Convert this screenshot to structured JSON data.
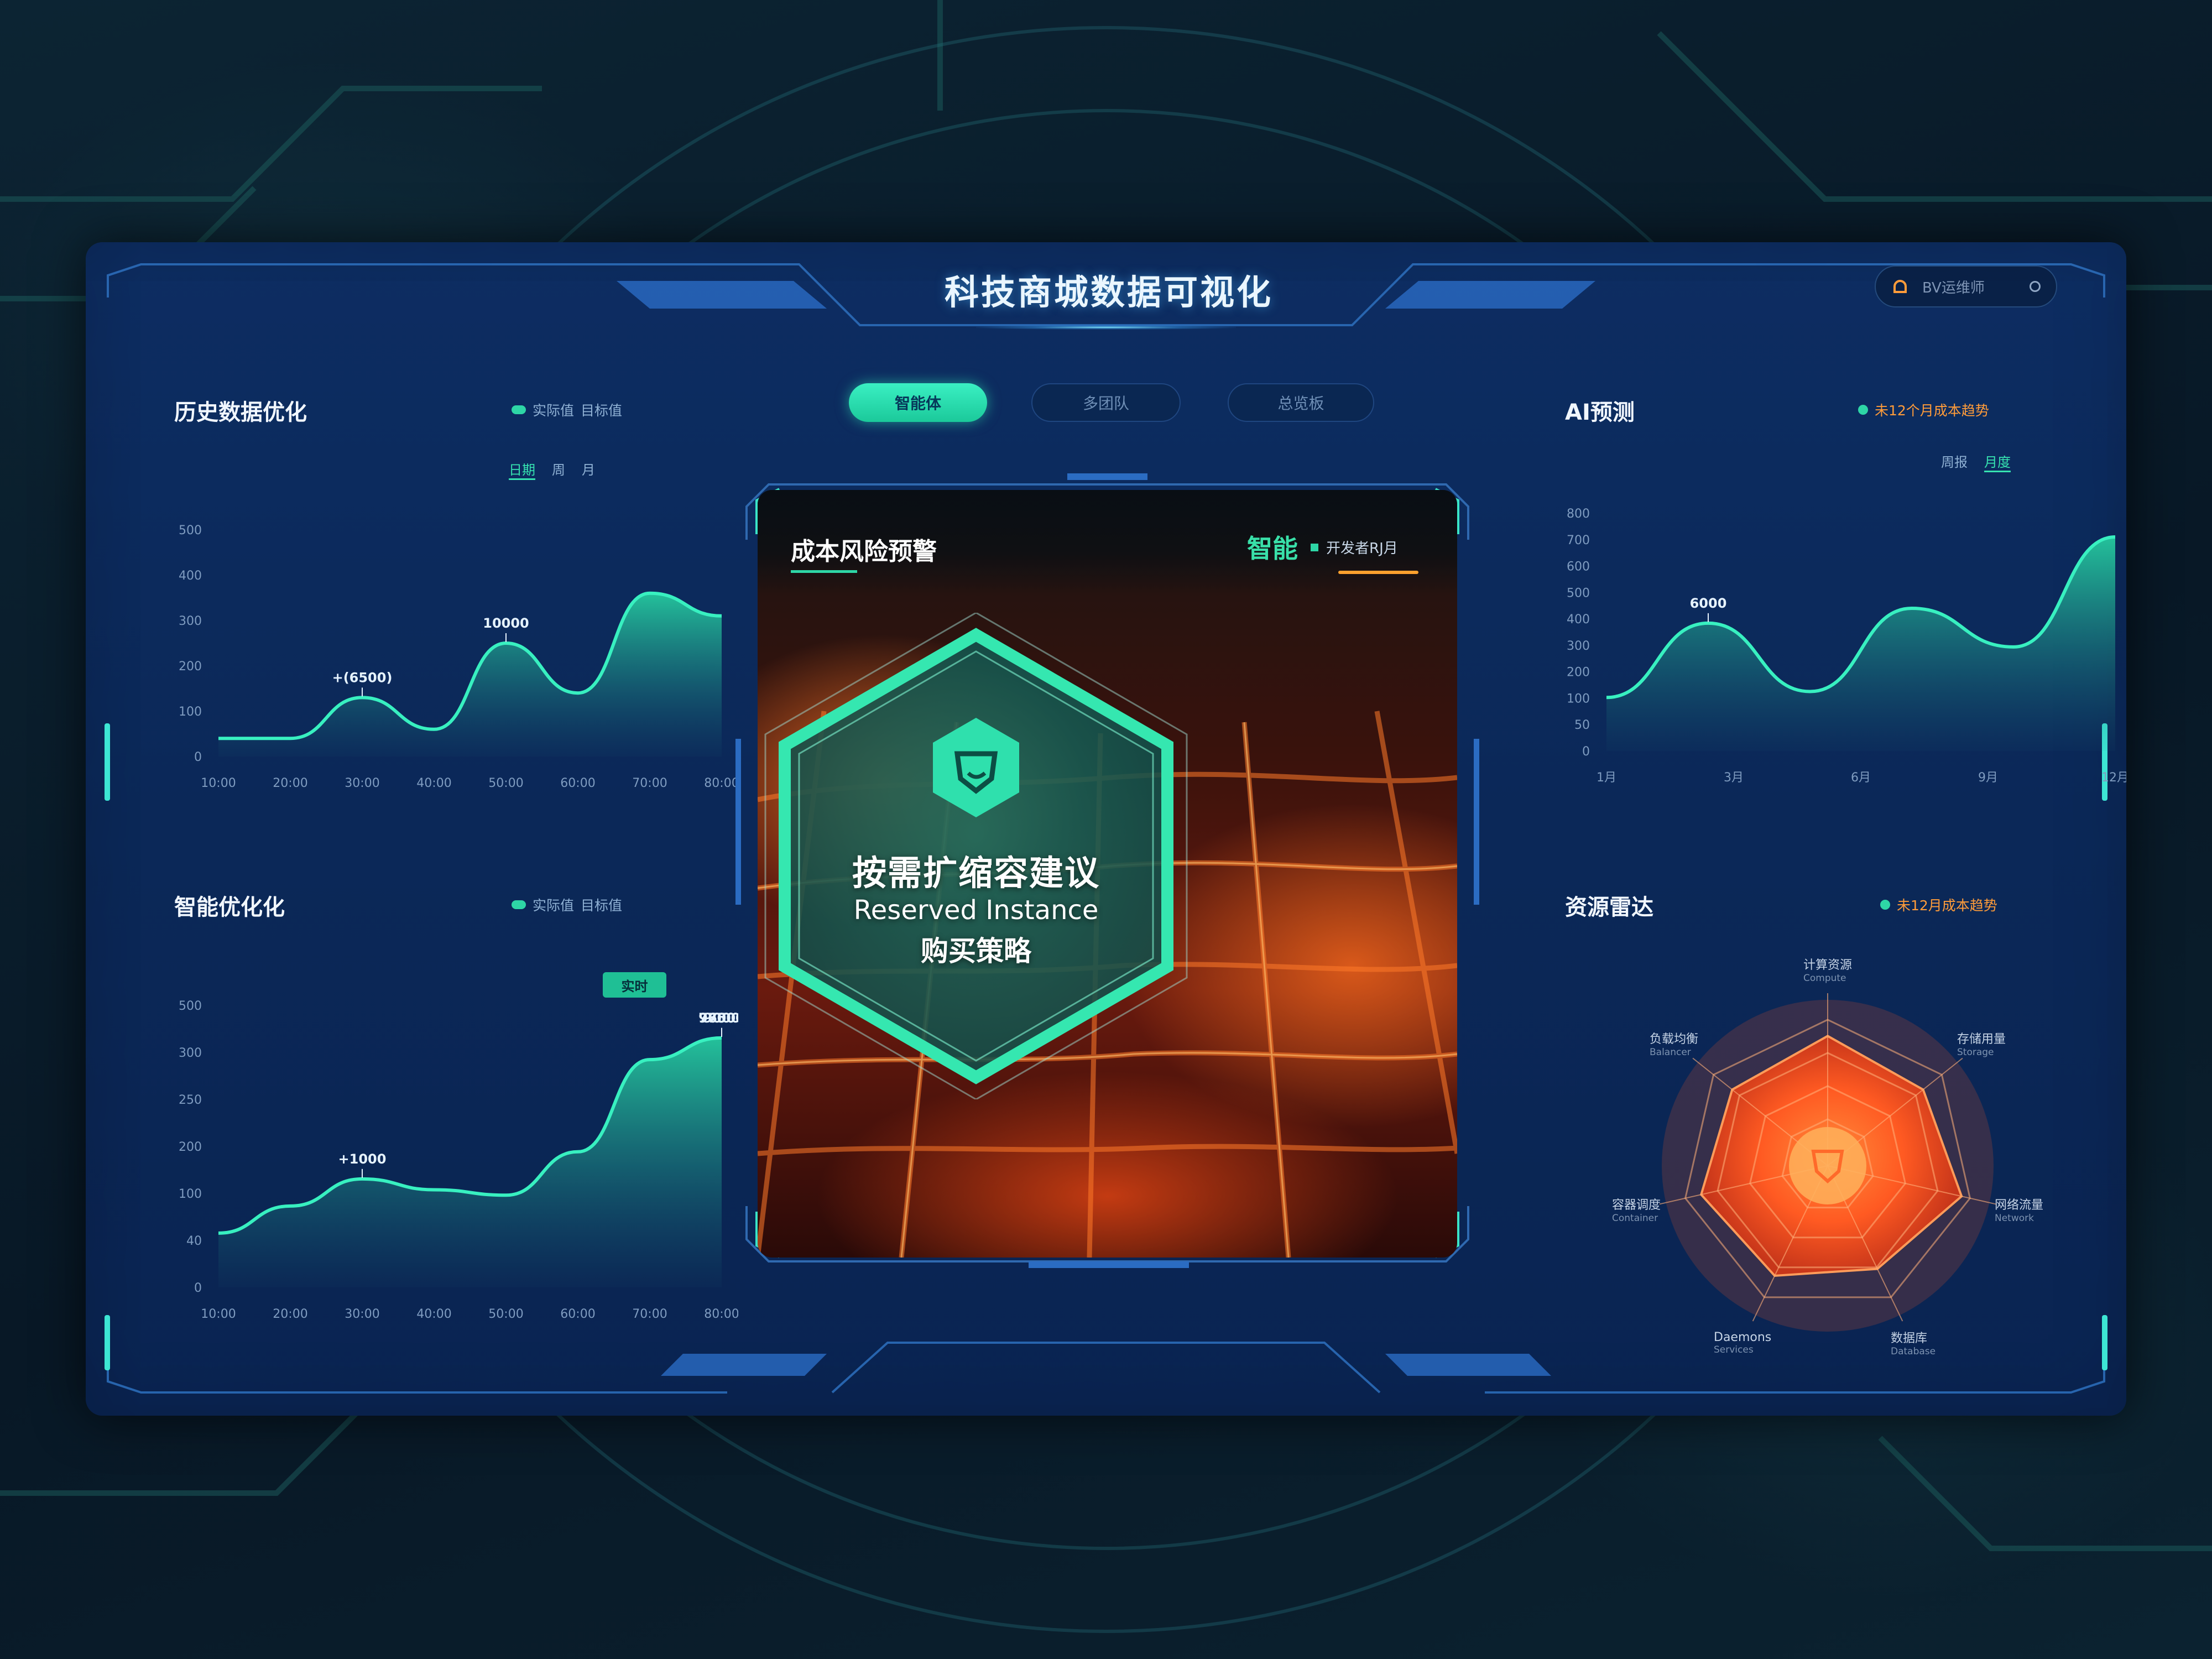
{
  "header": {
    "title": "科技商城数据可视化",
    "user_name": "BV运维师"
  },
  "tabs": [
    {
      "label": "智能体"
    },
    {
      "label": "多团队"
    },
    {
      "label": "总览板"
    }
  ],
  "left_top": {
    "title": "历史数据优化",
    "legend_label": "实际值",
    "legend_extra": "目标值",
    "filters": [
      "日期",
      "周",
      "月"
    ],
    "annotations": [
      "+(6500)",
      "10000"
    ]
  },
  "left_bottom": {
    "title": "智能优化化",
    "legend_label": "实际值",
    "legend_extra": "目标值",
    "badge": "实时",
    "annotations": [
      "+1000",
      "9000",
      "76000",
      "97500"
    ]
  },
  "right_top": {
    "title": "AI预测",
    "legend_label": "未12个月成本趋势",
    "filters": [
      "周报",
      "月度"
    ],
    "annotation": "6000"
  },
  "right_bottom": {
    "title": "资源雷达",
    "legend_label": "未12月成本趋势"
  },
  "center": {
    "title": "成本风险预警",
    "badge": "智能",
    "meta": "开发者RJ月",
    "hex_main": "按需扩缩容建议",
    "hex_sub1": "Reserved Instance",
    "hex_sub2": "购买策略"
  },
  "radar_labels": [
    {
      "label": "计算资源",
      "sub": "Compute"
    },
    {
      "label": "存储用量",
      "sub": "Storage"
    },
    {
      "label": "网络流量",
      "sub": "Network"
    },
    {
      "label": "数据库",
      "sub": "Database"
    },
    {
      "label": "Daemons",
      "sub": "Services"
    },
    {
      "label": "容器调度",
      "sub": "Container"
    },
    {
      "label": "负载均衡",
      "sub": "Balancer"
    }
  ],
  "chart_data": [
    {
      "type": "area",
      "title": "历史数据优化",
      "x": [
        "10:00",
        "20:00",
        "30:00",
        "40:00",
        "50:00",
        "60:00",
        "70:00",
        "80:00"
      ],
      "series": [
        {
          "name": "实际值",
          "values": [
            40,
            40,
            130,
            60,
            250,
            140,
            360,
            310
          ]
        }
      ],
      "yticks": [
        "0",
        "100",
        "200",
        "300",
        "400",
        "500"
      ],
      "ylim": [
        0,
        500
      ]
    },
    {
      "type": "area",
      "title": "智能优化化",
      "x": [
        "10:00",
        "20:00",
        "30:00",
        "40:00",
        "50:00",
        "60:00",
        "70:00",
        "80:00"
      ],
      "series": [
        {
          "name": "实际值",
          "values": [
            100,
            150,
            200,
            180,
            170,
            250,
            420,
            460
          ]
        }
      ],
      "yticks": [
        "0",
        "40",
        "100",
        "200",
        "250",
        "300",
        "500"
      ],
      "ylim": [
        0,
        520
      ]
    },
    {
      "type": "area",
      "title": "AI预测",
      "x": [
        "1月",
        "3月",
        "6月",
        "9月",
        "12月"
      ],
      "series": [
        {
          "name": "未12个月成本趋势",
          "values": [
            180,
            430,
            200,
            480,
            350,
            720
          ]
        }
      ],
      "yticks": [
        "0",
        "50",
        "100",
        "200",
        "300",
        "400",
        "500",
        "600",
        "700",
        "800"
      ],
      "ylim": [
        0,
        800
      ]
    },
    {
      "type": "radar",
      "title": "资源雷达",
      "categories": [
        "计算资源",
        "存储用量",
        "网络流量",
        "数据库",
        "Daemons",
        "容器调度",
        "负载均衡"
      ],
      "series": [
        {
          "name": "未12月成本趋势",
          "values": [
            0.85,
            0.8,
            0.9,
            0.75,
            0.8,
            0.85,
            0.8
          ]
        }
      ]
    }
  ]
}
